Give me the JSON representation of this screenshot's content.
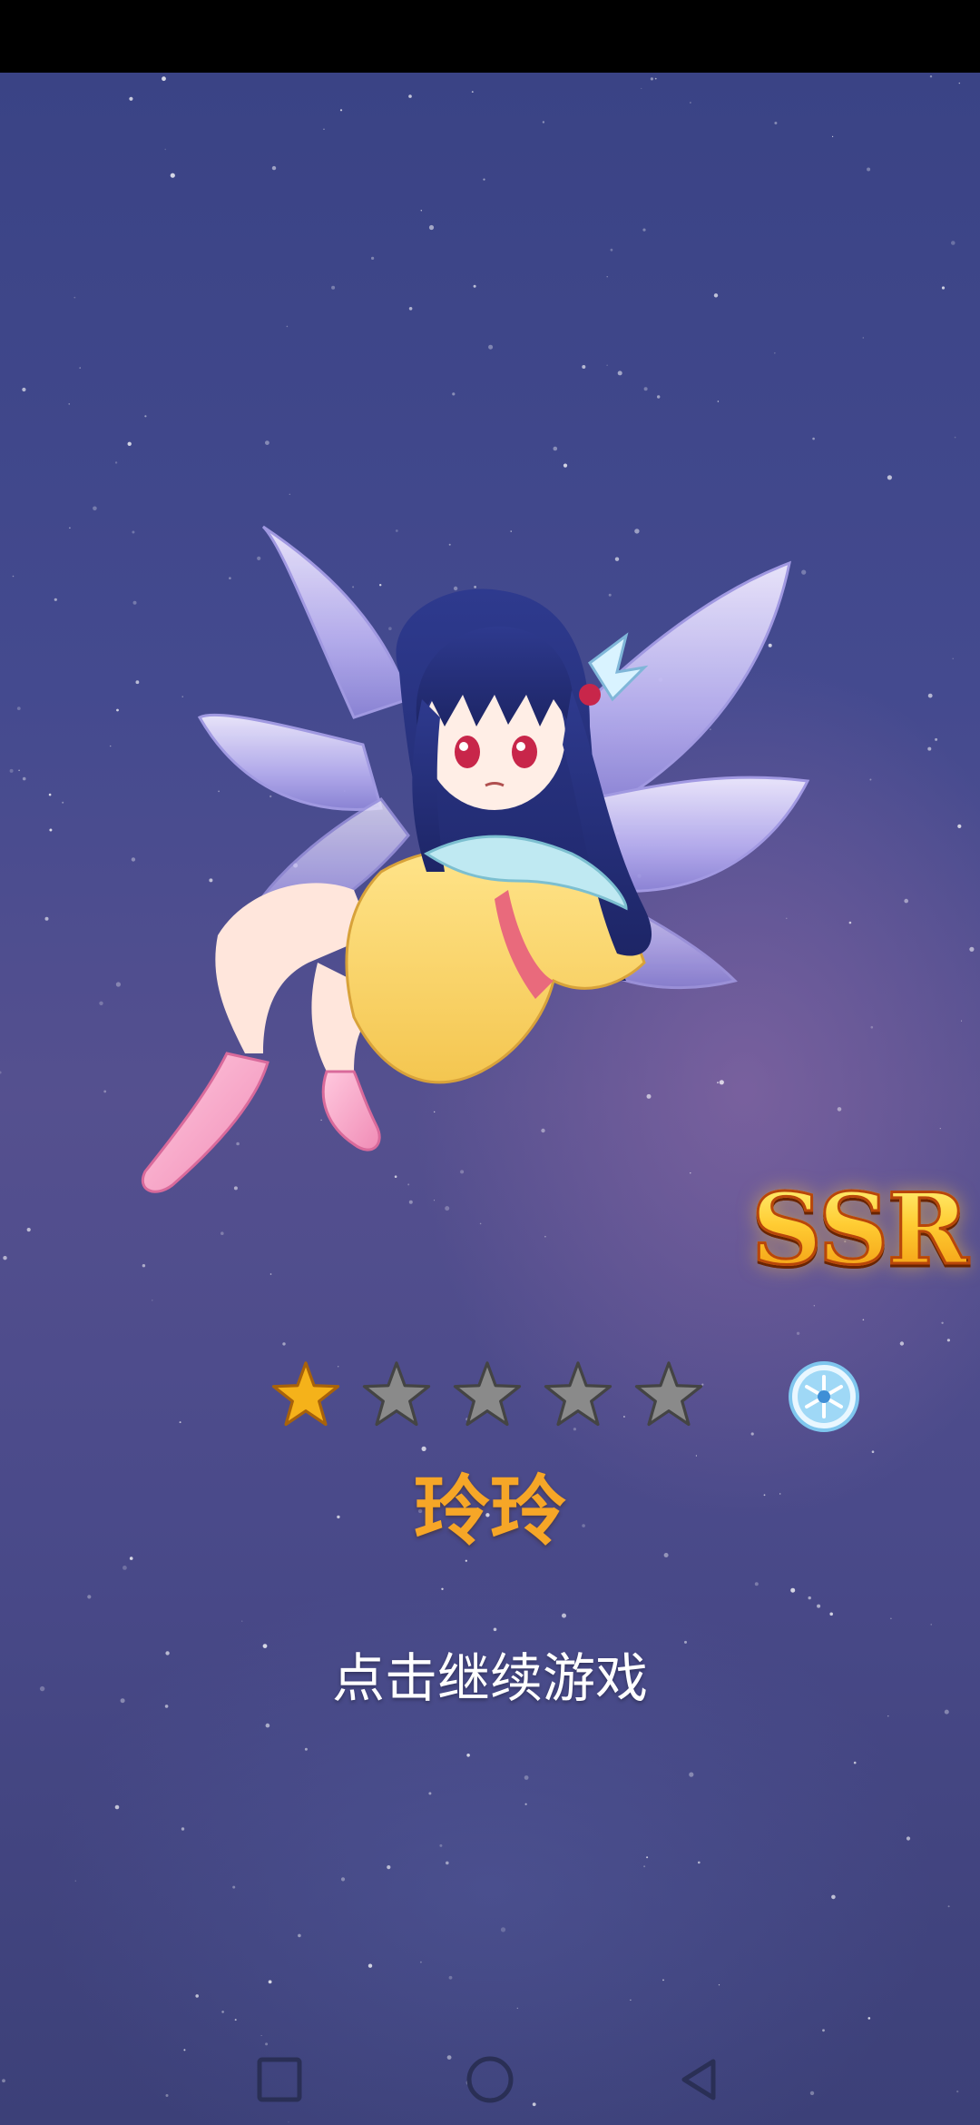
{
  "game": {
    "rarity": "SSR",
    "character_name": "玲玲",
    "star_rating": {
      "filled": 1,
      "total": 5
    },
    "element_icon": "snowflake-element-icon",
    "continue_prompt": "点击继续游戏"
  },
  "nav": {
    "recent_apps_icon": "square-icon",
    "home_icon": "circle-icon",
    "back_icon": "triangle-back-icon"
  },
  "colors": {
    "name": "#f6a627",
    "ssr_gold": "#ffc21a",
    "star_filled": "#f5b21a",
    "star_empty": "#8a8a8a",
    "background": "#444a8f"
  }
}
